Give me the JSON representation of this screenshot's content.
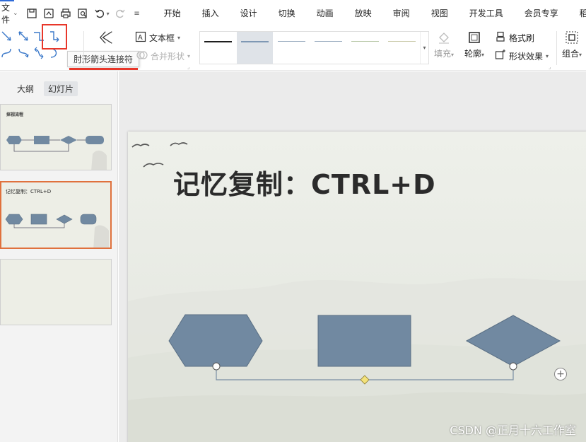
{
  "menu": {
    "file_label": "文件",
    "tabs": [
      "开始",
      "插入",
      "设计",
      "切换",
      "动画",
      "放映",
      "审阅",
      "视图",
      "开发工具",
      "会员专享",
      "稻壳资"
    ]
  },
  "ribbon": {
    "tooltip": "肘形箭头连接符",
    "textbox_label": "文本框",
    "merge_shape_label": "合并形状",
    "fill_label": "填充",
    "outline_label": "轮廓",
    "format_painter_label": "格式刷",
    "shape_effect_label": "形状效果",
    "group_label": "组合"
  },
  "panel": {
    "tabs": [
      "大纲",
      "幻灯片"
    ],
    "active_tab": "幻灯片",
    "slides": [
      {
        "title": "探视流程"
      },
      {
        "title": "记忆复制：CTRL+D"
      },
      {
        "title": ""
      }
    ]
  },
  "slide": {
    "title": "记忆复制：CTRL+D"
  },
  "watermark": "CSDN @正月十六工作室",
  "colors": {
    "shape_fill": "#7189a1",
    "shape_stroke": "#5a6f84",
    "highlight": "#e8372a",
    "selected_slide_border": "#e0713d",
    "connector": "#7a8fa3",
    "midpoint": "#f3e27a"
  }
}
